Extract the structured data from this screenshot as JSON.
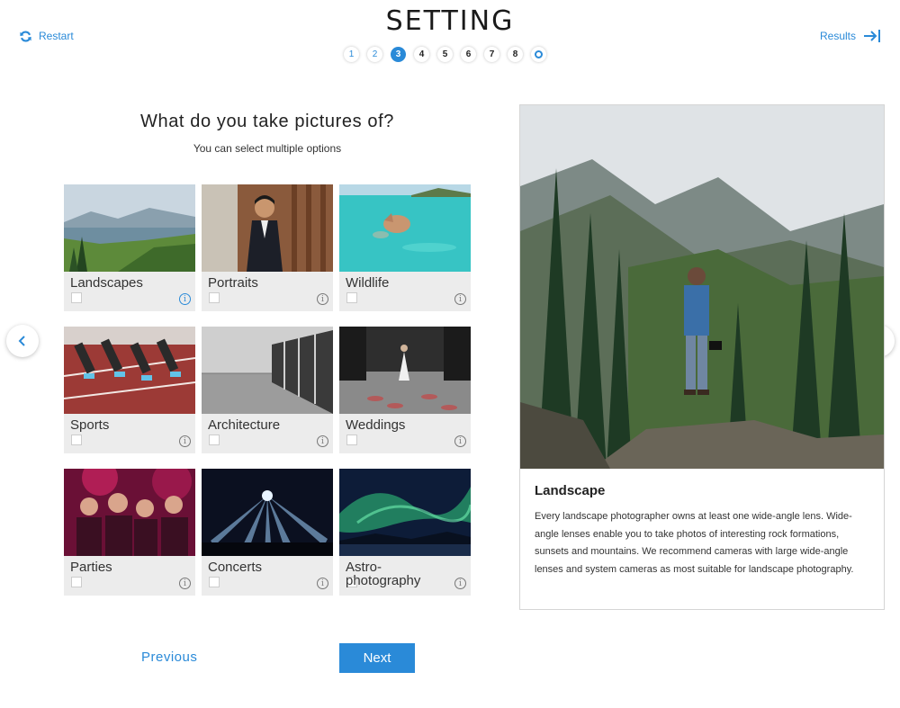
{
  "header": {
    "restart_label": "Restart",
    "title": "SETTING",
    "results_label": "Results"
  },
  "steps": [
    {
      "label": "1",
      "state": "done"
    },
    {
      "label": "2",
      "state": "done"
    },
    {
      "label": "3",
      "state": "active"
    },
    {
      "label": "4",
      "state": "todo"
    },
    {
      "label": "5",
      "state": "todo"
    },
    {
      "label": "6",
      "state": "todo"
    },
    {
      "label": "7",
      "state": "todo"
    },
    {
      "label": "8",
      "state": "todo"
    },
    {
      "label": "",
      "state": "final"
    }
  ],
  "question": {
    "title": "What do you take pictures of?",
    "hint": "You can select multiple options"
  },
  "options": [
    {
      "label": "Landscapes",
      "info_active": true
    },
    {
      "label": "Portraits"
    },
    {
      "label": "Wildlife"
    },
    {
      "label": "Sports"
    },
    {
      "label": "Architecture"
    },
    {
      "label": "Weddings"
    },
    {
      "label": "Parties"
    },
    {
      "label": "Concerts"
    },
    {
      "label": "Astro-\nphotography"
    }
  ],
  "info_icon_glyph": "i",
  "detail": {
    "title": "Landscape",
    "text": "Every landscape photographer owns at least one wide-angle lens. Wide-angle lenses enable you to take photos of interesting rock formations, sunsets and mountains. We recommend cameras with large wide-angle lenses and system cameras as most suitable for landscape photography."
  },
  "footer": {
    "previous_label": "Previous",
    "next_label": "Next"
  },
  "colors": {
    "accent": "#2a8ad8",
    "card_bg": "#ececec"
  }
}
